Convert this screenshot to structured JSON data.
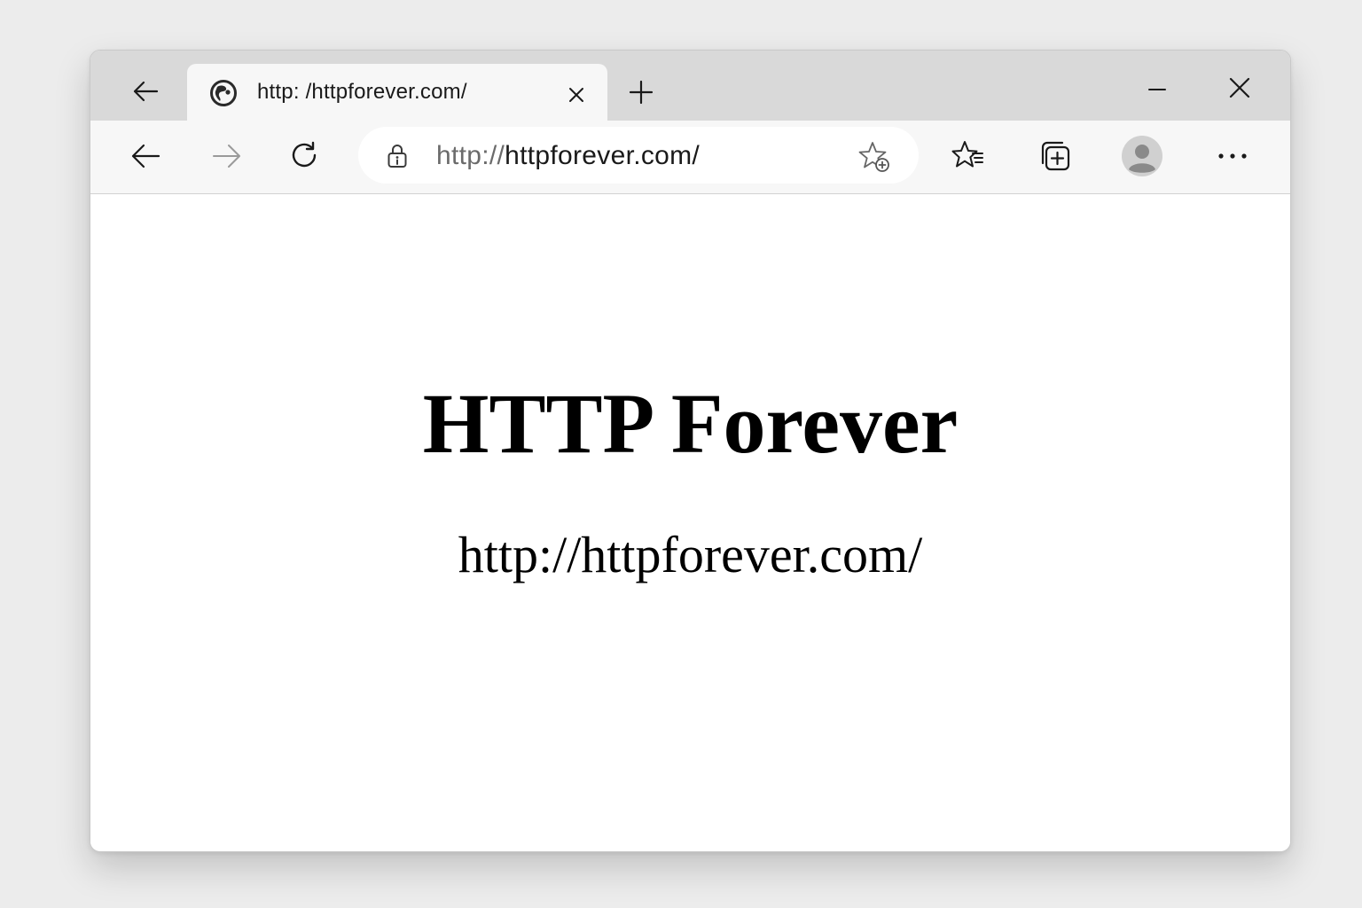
{
  "browser": {
    "tab": {
      "title": "http: /httpforever.com/",
      "favicon_icon": "globe-icon"
    },
    "address_bar": {
      "url_scheme": "http://",
      "url_host": "httpforever.com/",
      "security_icon": "lock-info-icon"
    },
    "icons": {
      "tab_back": "back-arrow-icon",
      "new_tab": "plus-icon",
      "minimize": "minimize-icon",
      "close_window": "close-icon",
      "back": "back-arrow-icon",
      "forward": "forward-arrow-icon",
      "refresh": "refresh-icon",
      "add_favorite": "star-plus-icon",
      "favorites": "favorites-icon",
      "collections": "collections-icon",
      "profile": "avatar-icon",
      "menu": "more-icon"
    }
  },
  "page": {
    "heading": "HTTP Forever",
    "link_text": "http://httpforever.com/"
  },
  "colors": {
    "chrome_background": "#d9d9d9",
    "toolbar_background": "#f7f7f7",
    "page_background": "#ffffff",
    "text": "#000000"
  }
}
